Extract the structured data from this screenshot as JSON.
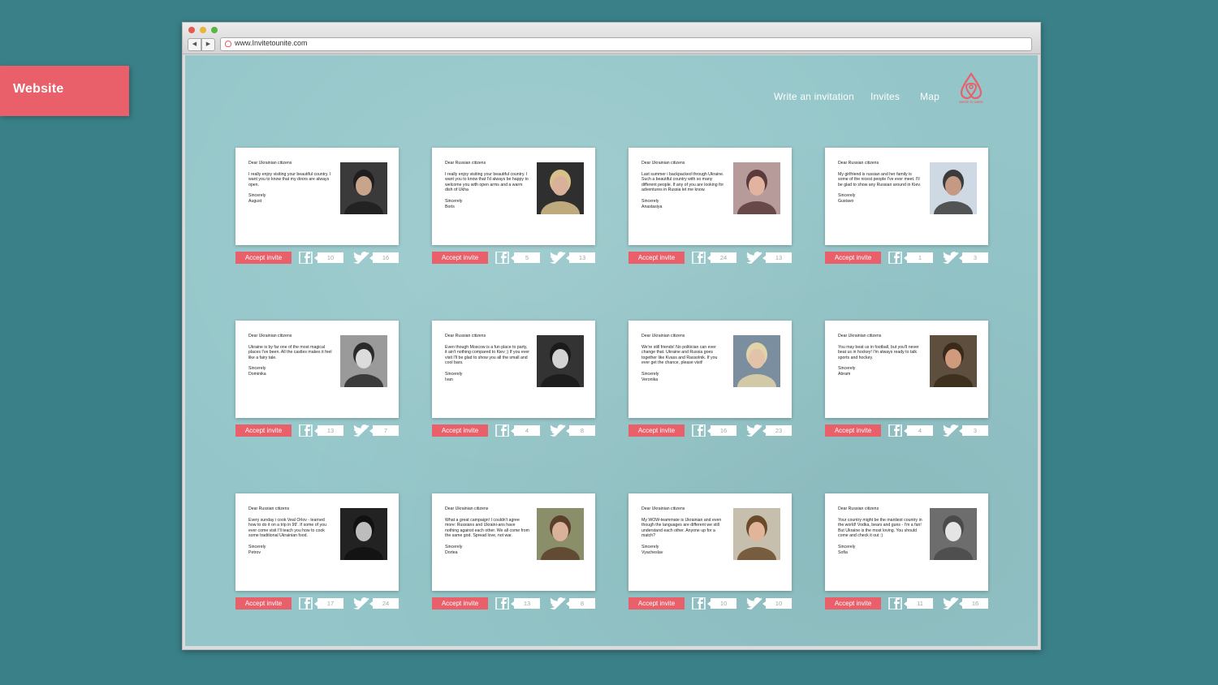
{
  "label": "Website",
  "browser": {
    "url": "www.Invitetounite.com",
    "back": "◀",
    "forward": "▶"
  },
  "nav": {
    "write": "Write an invitation",
    "invites": "Invites",
    "map": "Map",
    "logo_text": "INVITE TO UNITE"
  },
  "accept_label": "Accept invite",
  "colors": {
    "accent": "#e9606a",
    "page_bg": "#3a8088",
    "site_bg": "#94c6c9"
  },
  "cards": [
    {
      "greeting": "Dear Ukrainian citizens",
      "body": "I really enjoy visiting your beautiful country. I want you to know that my doors are always open.",
      "sign": "Sincerely",
      "name": "August",
      "fb": "10",
      "tw": "16",
      "photo": {
        "bg": "#3a3a3a",
        "face": "#c8a48a",
        "hair": "#1e1e1e"
      }
    },
    {
      "greeting": "Dear Russian citizens",
      "body": "I really enjoy visiting your beautiful country. I want you to know that I'd always be happy to welcome you with open arms and a warm dish of Ukha",
      "sign": "Sincerely",
      "name": "Boris",
      "fb": "5",
      "tw": "13",
      "photo": {
        "bg": "#2f2f2f",
        "face": "#d9b09a",
        "hair": "#d7c08a"
      }
    },
    {
      "greeting": "Dear Ukrainian citizens",
      "body": "Last summer i backpacked through Ukraine. Such a beautiful country with so many different people. If any of you are looking for adventures in Russia let me know.",
      "sign": "Sincerely",
      "name": "Anastasiya",
      "fb": "24",
      "tw": "13",
      "photo": {
        "bg": "#b79a9a",
        "face": "#e2b3a0",
        "hair": "#5a3a3a"
      }
    },
    {
      "greeting": "Dear Russian citizens",
      "body": "My girlfriend is russian and her family is some of the nicest people I've ever meet. I'll be glad to show any Russian around in Kiev.",
      "sign": "Sincerely",
      "name": "Gustavo",
      "fb": "1",
      "tw": "3",
      "photo": {
        "bg": "#cfd9e4",
        "face": "#c49a85",
        "hair": "#3b3b3b"
      }
    },
    {
      "greeting": "Dear Ukrainian citizens",
      "body": "Ukraine is by far one of the most magical places I've been. All the castles makes it feel like a fairy tale.",
      "sign": "Sincerely",
      "name": "Dominika",
      "fb": "13",
      "tw": "7",
      "photo": {
        "bg": "#9a9a9a",
        "face": "#dcdcdc",
        "hair": "#2a2a2a"
      }
    },
    {
      "greeting": "Dear Russian citizens",
      "body": "Even though Moscow is a fun place to party, it ain't nothing compared to Kiev ;) If you ever visit I'll be glad to show you all the small and cool bars.",
      "sign": "Sincerely",
      "name": "Ivan",
      "fb": "4",
      "tw": "8",
      "photo": {
        "bg": "#333",
        "face": "#d2d2d2",
        "hair": "#1a1a1a"
      }
    },
    {
      "greeting": "Dear Ukrainian citizens",
      "body": "We're still friends! No politician can ever change that. Ukraine and Russia goes together like Kvass and Rassolnik. If you ever get the chance, please visit!",
      "sign": "Sincerely",
      "name": "Veronika",
      "fb": "16",
      "tw": "23",
      "photo": {
        "bg": "#7a8ea0",
        "face": "#e3c2aa",
        "hair": "#e2d3a8"
      }
    },
    {
      "greeting": "Dear Ukrainian citizens",
      "body": "You may beat us in football, but you'll never beat us in hockey! I'm always ready to talk sports and hockey.",
      "sign": "Sincerely",
      "name": "Abram",
      "fb": "4",
      "tw": "3",
      "photo": {
        "bg": "#5e4e3e",
        "face": "#d09a7c",
        "hair": "#3a2a1a"
      }
    },
    {
      "greeting": "Dear Russian citizens",
      "body": "Every sunday i cook Veal Orlov - learned how to do it on a trip in 99'. If some of you ever come visit I'll teach you how to cook some traditional Ukrainian food.",
      "sign": "Sincerely",
      "name": "Petrov",
      "fb": "17",
      "tw": "24",
      "photo": {
        "bg": "#222",
        "face": "#bdbdbd",
        "hair": "#111"
      }
    },
    {
      "greeting": "Dear Ukrainian citizens",
      "body": "What a great campaign! I couldn't agree more: Russians and Ukraini-ans have nothing against each other. We all come from the same god. Spread love, not war.",
      "sign": "Sincerely",
      "name": "Dortea",
      "fb": "13",
      "tw": "8",
      "photo": {
        "bg": "#8a8f6a",
        "face": "#d9b29a",
        "hair": "#5a3f2a"
      }
    },
    {
      "greeting": "Dear Ukrainian citizens",
      "body": "My WOW-teammate is Ukrainian and even though the languages are different we still understand each other. Anyone up for a match?",
      "sign": "Sincerely",
      "name": "Vyacheslav",
      "fb": "10",
      "tw": "10",
      "photo": {
        "bg": "#c7bfae",
        "face": "#e0b59a",
        "hair": "#6a4a2a"
      }
    },
    {
      "greeting": "Dear Russian citizens",
      "body": "Your country might be the manliest country in the world! Vodka, bears and guns - I'm a fan! But Ukraine is the most loving. You should come and check it out :)",
      "sign": "Sincerely",
      "name": "Sofia",
      "fb": "11",
      "tw": "16",
      "photo": {
        "bg": "#6d6d6d",
        "face": "#e4e4e4",
        "hair": "#4a4a4a"
      }
    }
  ]
}
